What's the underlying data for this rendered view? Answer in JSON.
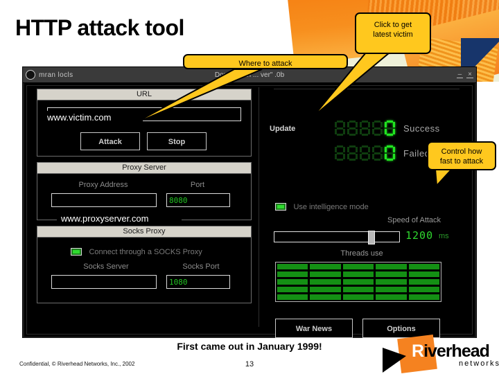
{
  "slide": {
    "title": "HTTP attack tool",
    "caption": "First came out in January 1999!",
    "confidential": "Confidential, © Riverhead Networks, Inc., 2002",
    "page_number": "13"
  },
  "logo": {
    "r": "R",
    "name_rest": "iverhead",
    "subtitle": "networks"
  },
  "callouts": [
    {
      "name": "where-to-attack",
      "text": "Where to attack"
    },
    {
      "name": "click-to-get-latest-victim",
      "text": "Click to get\nlatest victim",
      "line1": "Click to get",
      "line2": "latest victim"
    },
    {
      "name": "control-how-fast",
      "text": "Control how\nfast to attack",
      "line1": "Control how",
      "line2": "fast to attack"
    }
  ],
  "overlays": {
    "victim_url": "www.victim.com",
    "proxy_address": "www.proxyserver.com"
  },
  "window": {
    "titlebar": {
      "left_text": "mran locls",
      "center_text": "Dorash Win ... ver\" .0b",
      "minimize": "–",
      "close": "×"
    },
    "url_group": {
      "caption": "URL",
      "value": "",
      "placeholder": "",
      "attack_button": "Attack",
      "stop_button": "Stop"
    },
    "counters": {
      "update_label": "Update",
      "success": {
        "label": "Success",
        "value": "0",
        "digits": 5
      },
      "failed": {
        "label": "Failed",
        "value": "0",
        "digits": 5
      }
    },
    "intelligence": {
      "checkbox_label": "Use intelligence mode",
      "checked": true
    },
    "speed": {
      "label": "Speed of Attack",
      "value": "1200",
      "units": "ms",
      "slider_percent": 75
    },
    "threads": {
      "label": "Threads use",
      "rows": 5,
      "cols": 5
    },
    "proxy_group": {
      "caption": "Proxy Server",
      "address_label": "Proxy Address",
      "address_value": "",
      "port_label": "Port",
      "port_value": "8080"
    },
    "socks_group": {
      "caption": "Socks Proxy",
      "checkbox_label": "Connect through a SOCKS Proxy",
      "checked": true,
      "server_label": "Socks Server",
      "server_value": "",
      "port_label": "Socks Port",
      "port_value": "1080"
    },
    "buttons": {
      "war_news": "War News",
      "options": "Options"
    }
  },
  "colors": {
    "callout": "#ffc81e",
    "led_on": "#21e421",
    "led_off": "#0f3d0f",
    "thread_bar": "#149014",
    "brand_orange": "#f58220",
    "window_bg": "#000000"
  }
}
